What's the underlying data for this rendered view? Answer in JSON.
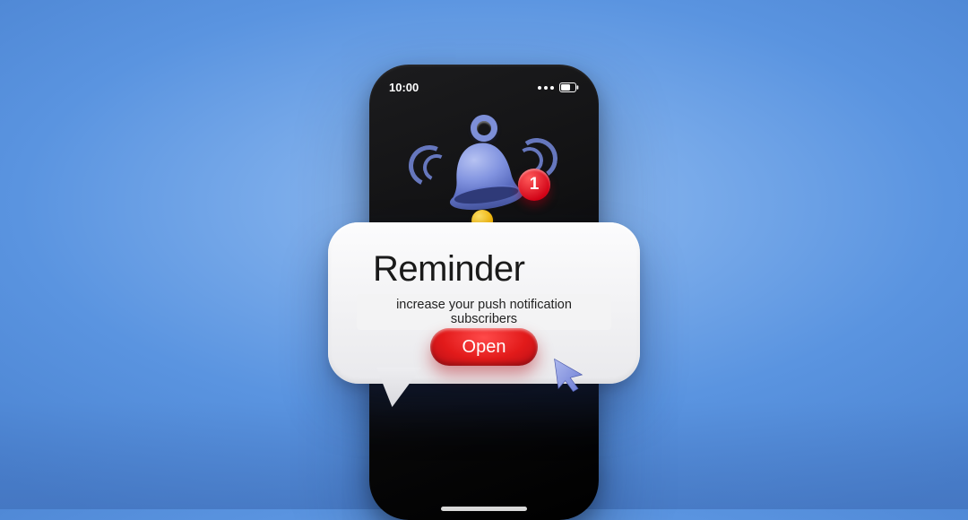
{
  "phone": {
    "time": "10:00",
    "badge_count": "1"
  },
  "notification": {
    "title": "Reminder",
    "subtitle": "increase your push notification subscribers",
    "button_label": "Open"
  },
  "colors": {
    "accent_red": "#d81022",
    "bell_blue": "#7d8fd8",
    "background": "#6a9ce6"
  }
}
